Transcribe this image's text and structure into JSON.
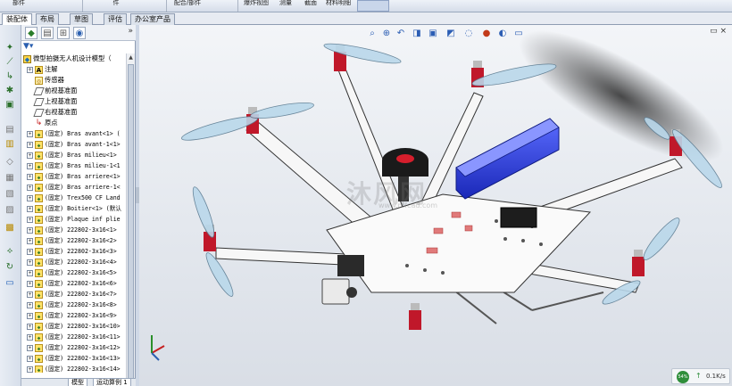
{
  "ribbon": {
    "labels": [
      "部件",
      "件",
      "配合/部件",
      "爆炸视图",
      "测量",
      "截面",
      "材料明细"
    ],
    "colors": {
      "active": "#c9d6ea"
    }
  },
  "tabs": [
    {
      "label": "装配体",
      "active": true
    },
    {
      "label": "布局",
      "active": false
    },
    {
      "label": "草图",
      "active": false
    },
    {
      "label": "评估",
      "active": false
    },
    {
      "label": "办公室产品",
      "active": false
    }
  ],
  "feature_tree": {
    "root": "微型拍摄无人机设计模型（",
    "items": [
      {
        "label": "注解",
        "icon": "note-icon"
      },
      {
        "label": "传感器",
        "icon": "sensor-icon"
      },
      {
        "label": "前视基准面",
        "icon": "plane-icon"
      },
      {
        "label": "上视基准面",
        "icon": "plane-icon"
      },
      {
        "label": "右视基准面",
        "icon": "plane-icon"
      },
      {
        "label": "原点",
        "icon": "origin-icon"
      }
    ],
    "components": [
      "(固定) Bras avant<1> (",
      "(固定) Bras avant-1<1>",
      "(固定) Bras milieu<1>",
      "(固定) Bras milieu-1<1",
      "(固定) Bras arriere<1>",
      "(固定) Bras arriere-1<",
      "(固定) Trex500 CF Land",
      "(固定) Boitier<1> (默认",
      "(固定) Plaque inf plie",
      "(固定) 222802-3x16<1>",
      "(固定) 222802-3x16<2>",
      "(固定) 222802-3x16<3>",
      "(固定) 222802-3x16<4>",
      "(固定) 222802-3x16<5>",
      "(固定) 222802-3x16<6>",
      "(固定) 222802-3x16<7>",
      "(固定) 222802-3x16<8>",
      "(固定) 222802-3x16<9>",
      "(固定) 222802-3x16<10>",
      "(固定) 222802-3x16<11>",
      "(固定) 222802-3x16<12>",
      "(固定) 222802-3x16<13>",
      "(固定) 222802-3x16<14>"
    ]
  },
  "bottom_tabs": [
    "模型",
    "运动算例 1"
  ],
  "watermark": {
    "text": "沐风网",
    "url": "www.mfcad.com"
  },
  "status": {
    "speed": "0.1K/s",
    "badge": "54%"
  },
  "colors": {
    "frame_white": "#f5f5f5",
    "motor_red": "#c0182a",
    "battery_blue": "#2436d8",
    "prop_blue": "#b9d7ea"
  }
}
